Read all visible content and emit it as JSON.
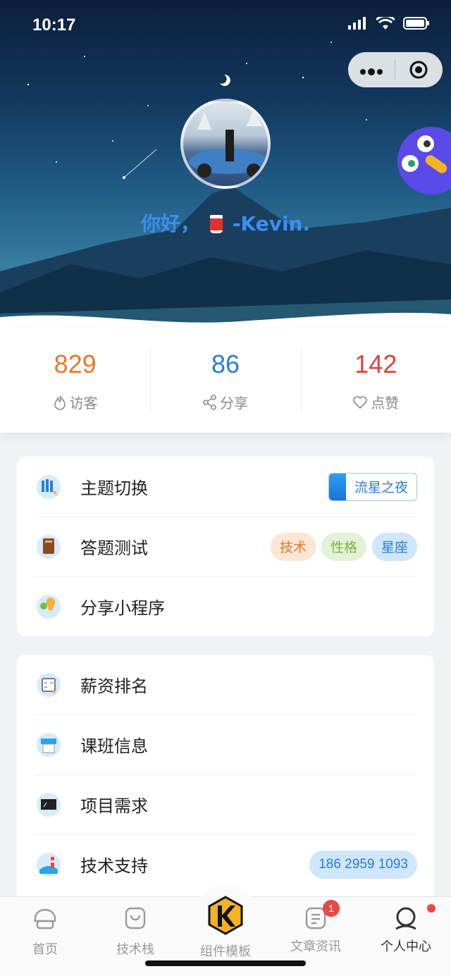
{
  "status_bar": {
    "time": "10:17"
  },
  "header": {
    "greeting_prefix": "你好，",
    "greeting_name": "-Kevin."
  },
  "stats": [
    {
      "value": "829",
      "label": "访客",
      "color": "#e47a2e",
      "icon": "flame-icon"
    },
    {
      "value": "86",
      "label": "分享",
      "color": "#2a7dd6",
      "icon": "share-icon"
    },
    {
      "value": "142",
      "label": "点赞",
      "color": "#d9453f",
      "icon": "heart-icon"
    }
  ],
  "menu1": {
    "theme": {
      "label": "主题切换",
      "tag": "流星之夜"
    },
    "quiz": {
      "label": "答题测试",
      "tags": [
        "技术",
        "性格",
        "星座"
      ]
    },
    "share": {
      "label": "分享小程序"
    }
  },
  "menu2": {
    "salary": {
      "label": "薪资排名"
    },
    "classes": {
      "label": "课班信息"
    },
    "projects": {
      "label": "项目需求"
    },
    "support": {
      "label": "技术支持",
      "phone": "186 2959 1093"
    }
  },
  "tabbar": {
    "tabs": [
      {
        "label": "首页",
        "icon": "home-icon"
      },
      {
        "label": "技术栈",
        "icon": "bag-icon"
      },
      {
        "label": "组件模板",
        "icon": "k-logo-icon"
      },
      {
        "label": "文章资讯",
        "icon": "article-icon",
        "badge": "1"
      },
      {
        "label": "个人中心",
        "icon": "user-icon"
      }
    ]
  },
  "colors": {
    "accent": "#2a7dd6",
    "orange": "#e47a2e",
    "red": "#d9453f",
    "green": "#7cb342"
  }
}
